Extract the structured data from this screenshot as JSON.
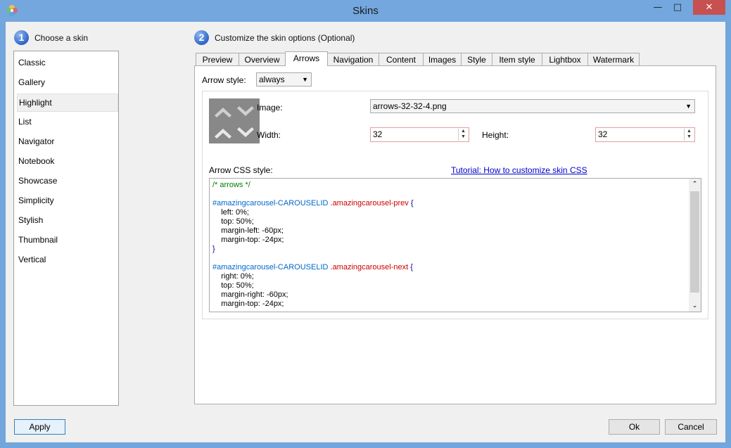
{
  "window": {
    "title": "Skins",
    "minimize_glyph": "—",
    "maximize_glyph": "□",
    "close_glyph": "✕"
  },
  "step1": {
    "number": "1",
    "label": "Choose a skin"
  },
  "step2": {
    "number": "2",
    "label": "Customize the skin options (Optional)"
  },
  "skins": [
    "Classic",
    "Gallery",
    "Highlight",
    "List",
    "Navigator",
    "Notebook",
    "Showcase",
    "Simplicity",
    "Stylish",
    "Thumbnail",
    "Vertical"
  ],
  "selected_skin": "Highlight",
  "tabs": [
    "Preview",
    "Overview",
    "Arrows",
    "Navigation",
    "Content",
    "Images",
    "Style",
    "Item style",
    "Lightbox",
    "Watermark"
  ],
  "active_tab": "Arrows",
  "arrows": {
    "arrow_style_label": "Arrow style:",
    "arrow_style_value": "always",
    "image_label": "Image:",
    "image_value": "arrows-32-32-4.png",
    "width_label": "Width:",
    "width_value": "32",
    "height_label": "Height:",
    "height_value": "32",
    "css_label": "Arrow CSS style:",
    "tutorial_link": "Tutorial: How to customize skin CSS",
    "css_lines": [
      {
        "parts": [
          {
            "t": "/* arrows */",
            "c": "comment"
          }
        ]
      },
      {
        "parts": []
      },
      {
        "parts": [
          {
            "t": "#amazingcarousel-CAROUSELID",
            "c": "id"
          },
          {
            "t": " .amazingcarousel-prev",
            "c": "class"
          },
          {
            "t": " {",
            "c": "brace"
          }
        ]
      },
      {
        "parts": [
          {
            "t": "    left: 0%;",
            "c": ""
          }
        ]
      },
      {
        "parts": [
          {
            "t": "    top: 50%;",
            "c": ""
          }
        ]
      },
      {
        "parts": [
          {
            "t": "    margin-left: -60px;",
            "c": ""
          }
        ]
      },
      {
        "parts": [
          {
            "t": "    margin-top: -24px;",
            "c": ""
          }
        ]
      },
      {
        "parts": [
          {
            "t": "}",
            "c": "brace"
          }
        ]
      },
      {
        "parts": []
      },
      {
        "parts": [
          {
            "t": "#amazingcarousel-CAROUSELID",
            "c": "id"
          },
          {
            "t": " .amazingcarousel-next",
            "c": "class"
          },
          {
            "t": " {",
            "c": "brace"
          }
        ]
      },
      {
        "parts": [
          {
            "t": "    right: 0%;",
            "c": ""
          }
        ]
      },
      {
        "parts": [
          {
            "t": "    top: 50%;",
            "c": ""
          }
        ]
      },
      {
        "parts": [
          {
            "t": "    margin-right: -60px;",
            "c": ""
          }
        ]
      },
      {
        "parts": [
          {
            "t": "    margin-top: -24px;",
            "c": ""
          }
        ]
      }
    ]
  },
  "buttons": {
    "apply": "Apply",
    "ok": "Ok",
    "cancel": "Cancel"
  },
  "colors": {
    "titlebar": "#73a7de",
    "close": "#c75050",
    "link": "#0000cc",
    "comment": "#008000",
    "id": "#0066cc",
    "class": "#cc0000"
  }
}
